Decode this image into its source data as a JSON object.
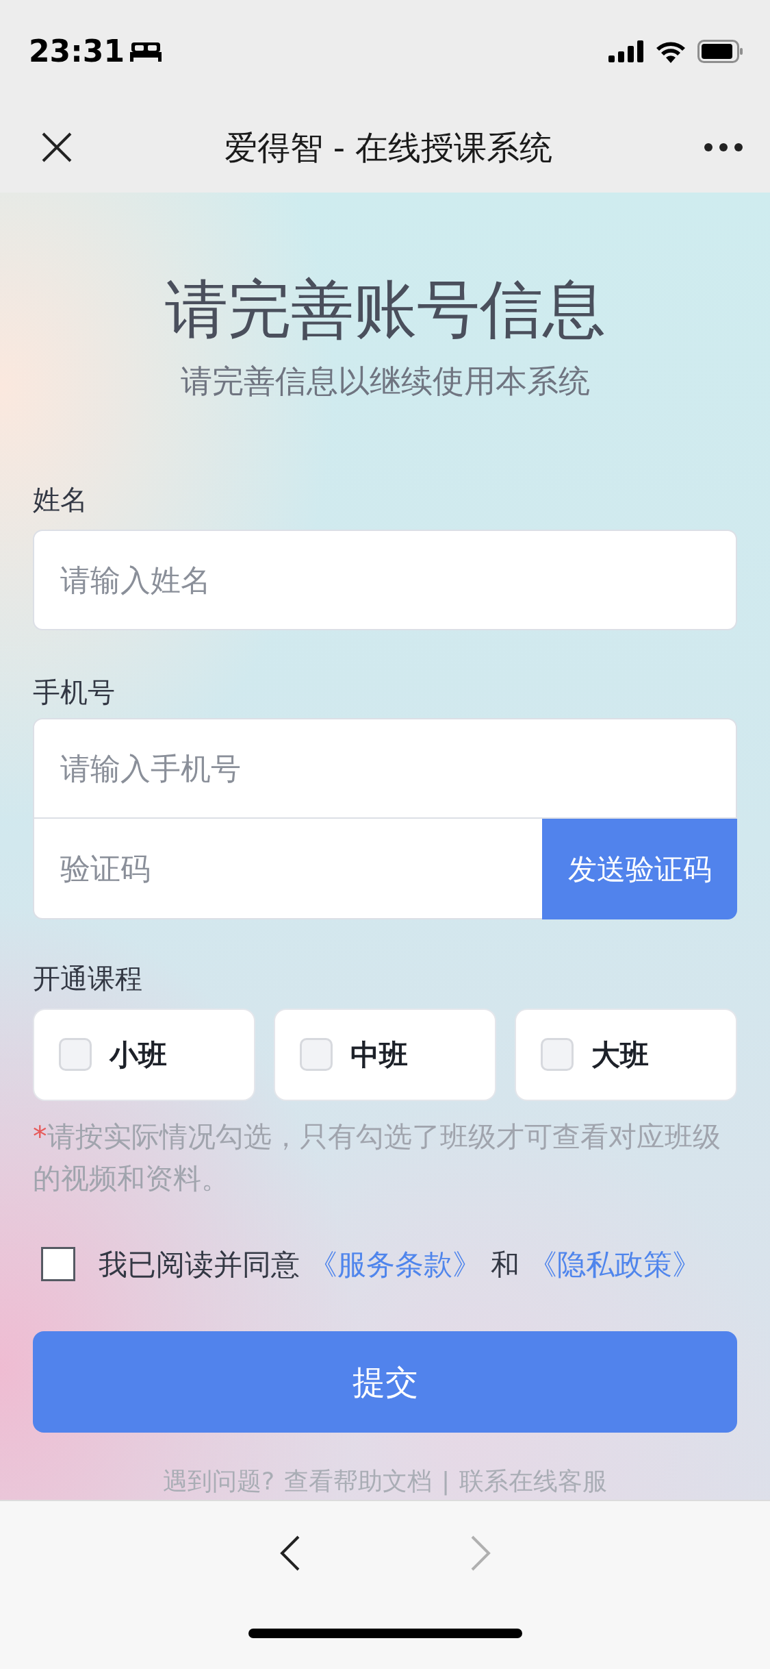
{
  "status_bar": {
    "time": "23:31"
  },
  "nav_bar": {
    "title": "爱得智 - 在线授课系统"
  },
  "heading": "请完善账号信息",
  "subtitle": "请完善信息以继续使用本系统",
  "name_field": {
    "label": "姓名",
    "placeholder": "请输入姓名"
  },
  "phone_field": {
    "label": "手机号",
    "placeholder": "请输入手机号"
  },
  "code_field": {
    "placeholder": "验证码",
    "button": "发送验证码"
  },
  "courses": {
    "label": "开通课程",
    "options": [
      {
        "label": "小班",
        "checked": false
      },
      {
        "label": "中班",
        "checked": false
      },
      {
        "label": "大班",
        "checked": false
      }
    ]
  },
  "note": {
    "required_mark": "*",
    "text": "请按实际情况勾选，只有勾选了班级才可查看对应班级的视频和资料。"
  },
  "agreement": {
    "checked": false,
    "text": "我已阅读并同意",
    "terms_link": "《服务条款》",
    "conjunction": "和",
    "privacy_link": "《隐私政策》"
  },
  "submit_button": "提交",
  "footer": {
    "question": "遇到问题?",
    "help_link": "查看帮助文档",
    "separator": "|",
    "support_link": "联系在线客服"
  },
  "toolbar": {
    "back": {
      "disabled": false
    },
    "forward": {
      "disabled": true
    }
  }
}
